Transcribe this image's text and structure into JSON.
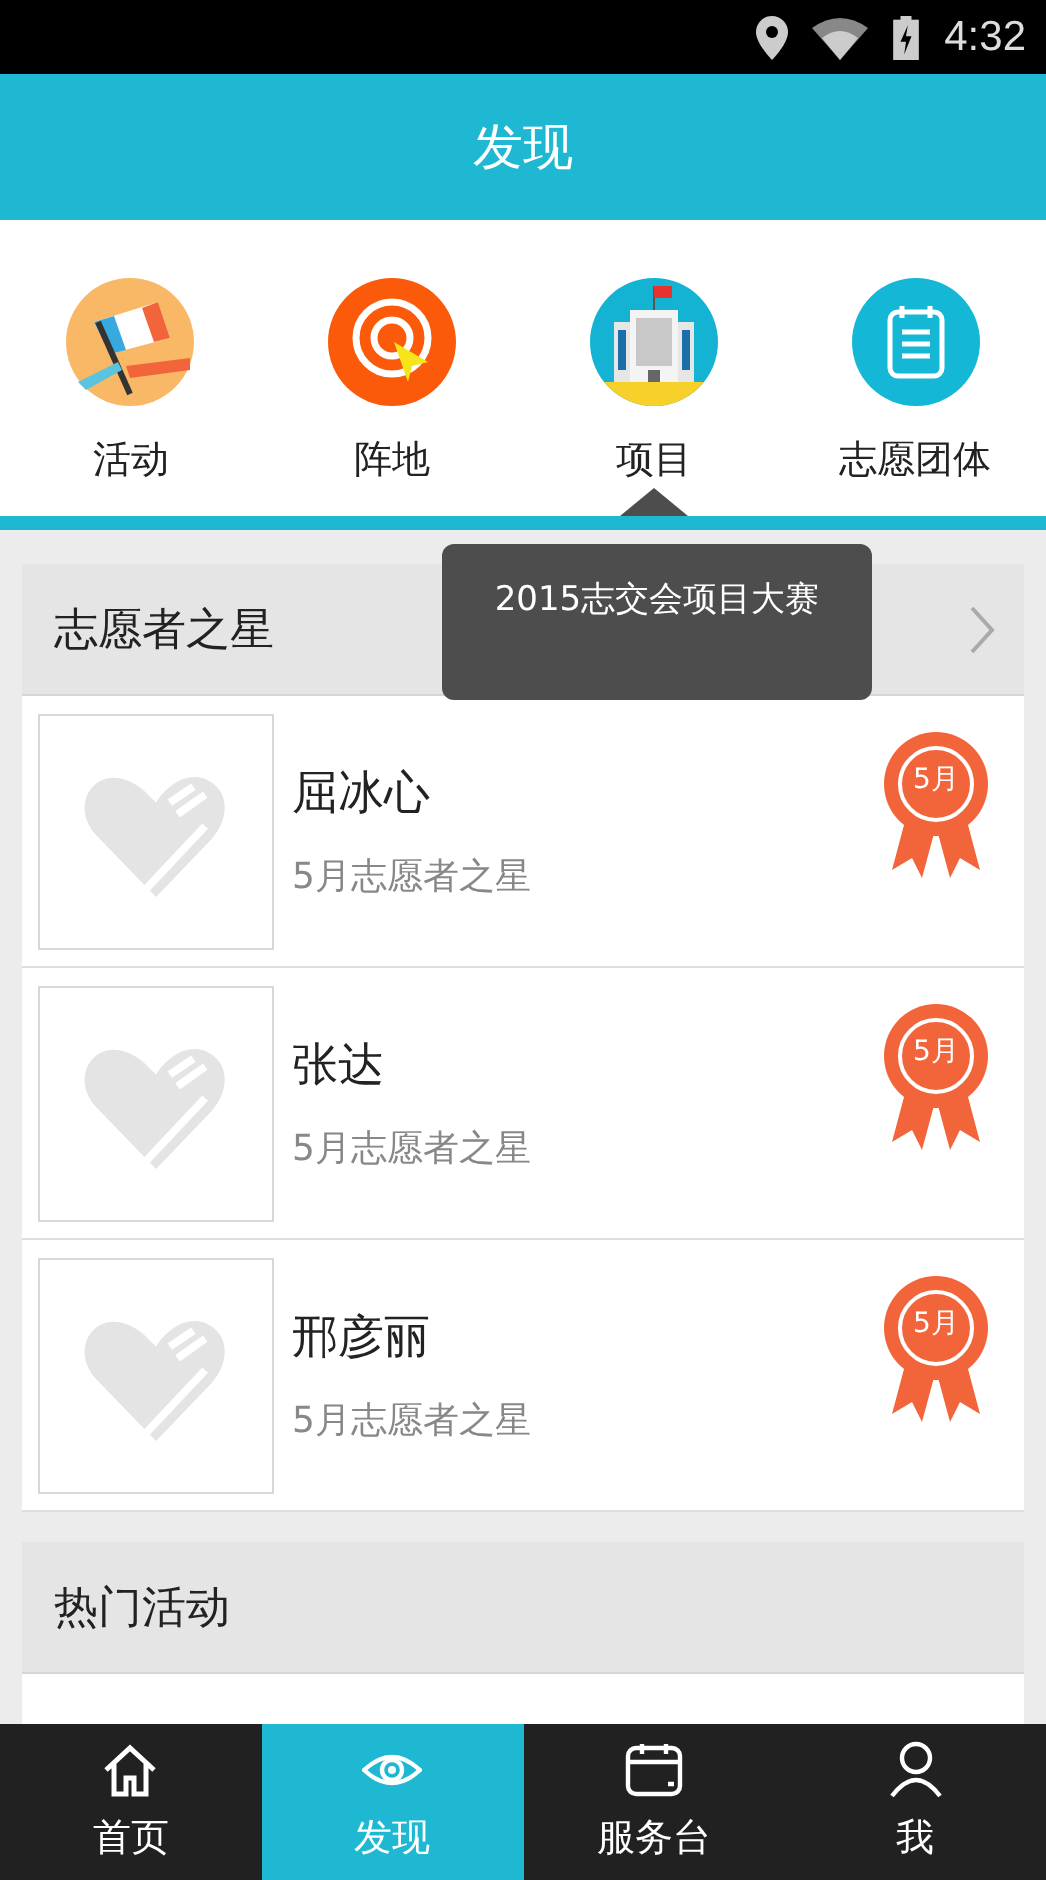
{
  "status_bar": {
    "time": "4:32"
  },
  "header": {
    "title": "发现"
  },
  "nav": [
    {
      "label": "活动",
      "kind": "flag",
      "selected": false
    },
    {
      "label": "阵地",
      "kind": "target",
      "selected": false
    },
    {
      "label": "项目",
      "kind": "building",
      "selected": true
    },
    {
      "label": "志愿团体",
      "kind": "notepad",
      "selected": false
    }
  ],
  "tooltip": {
    "text": "2015志交会项目大赛"
  },
  "stars_section": {
    "title": "志愿者之星",
    "items": [
      {
        "name": "屈冰心",
        "subtitle": "5月志愿者之星",
        "badge": "5月"
      },
      {
        "name": "张达",
        "subtitle": "5月志愿者之星",
        "badge": "5月"
      },
      {
        "name": "邢彦丽",
        "subtitle": "5月志愿者之星",
        "badge": "5月"
      }
    ]
  },
  "hot_section": {
    "title": "热门活动"
  },
  "tabs": [
    {
      "label": "首页",
      "kind": "home",
      "selected": false
    },
    {
      "label": "发现",
      "kind": "eye",
      "selected": true
    },
    {
      "label": "服务台",
      "kind": "calendar",
      "selected": false
    },
    {
      "label": "我",
      "kind": "person",
      "selected": false
    }
  ]
}
